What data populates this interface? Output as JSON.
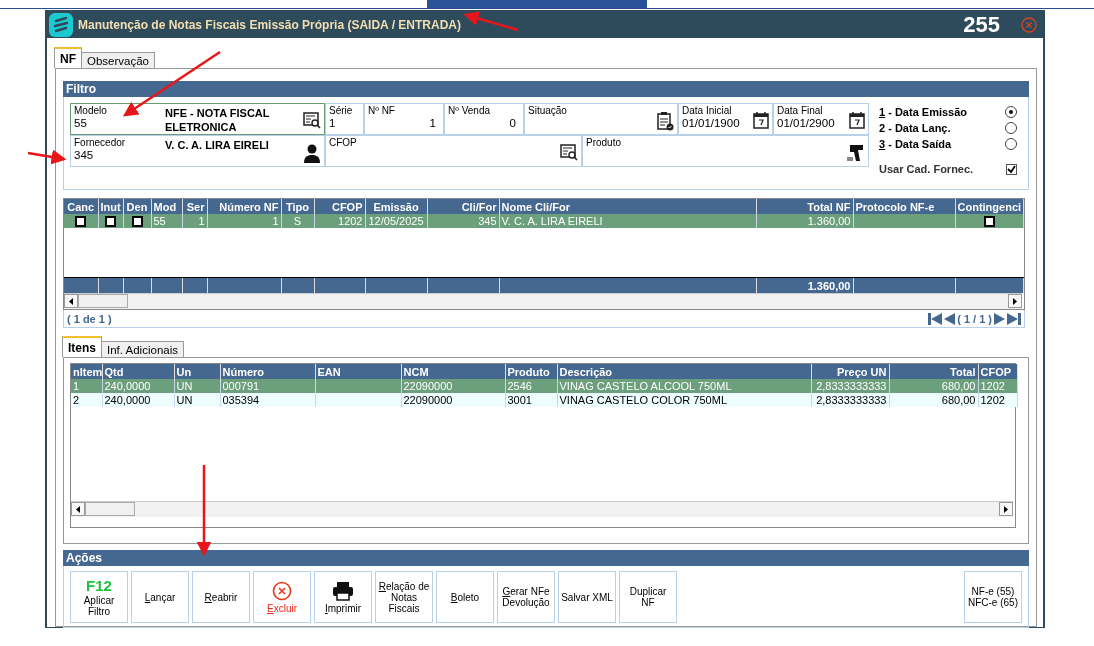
{
  "window": {
    "title": "Manutenção de Notas Fiscais Emissão Própria (SAIDA / ENTRADA)",
    "number": "255"
  },
  "tabs": [
    {
      "label": "NF",
      "selected": true
    },
    {
      "label": "Observação",
      "selected": false
    }
  ],
  "filter": {
    "title": "Filtro",
    "row_1": [
      {
        "label": "Modelo",
        "value": "55",
        "description": "NFE - NOTA FISCAL ELETRONICA",
        "kind": "lookup",
        "focused": true
      },
      {
        "label": "Série",
        "value": "1",
        "kind": "text"
      },
      {
        "label": "Nº NF",
        "value": "1",
        "kind": "number"
      },
      {
        "label": "Nº Venda",
        "value": "0",
        "kind": "number"
      },
      {
        "label": "Situação",
        "kind": "clipboard"
      },
      {
        "label": "Data Inicial",
        "value": "01/01/1900",
        "kind": "calendar"
      },
      {
        "label": "Data Final",
        "value": "01/01/2900",
        "kind": "calendar"
      }
    ],
    "row_2": [
      {
        "label": "Fornecedor",
        "value": "345",
        "description": "V. C. A. LIRA EIRELI",
        "kind": "person",
        "focused": false
      },
      {
        "label": "CFOP",
        "kind": "lookup"
      },
      {
        "label": "Produto",
        "kind": "scanner"
      }
    ],
    "date_options": [
      {
        "label": "1 - Data Emissão",
        "accel": true,
        "selected": true
      },
      {
        "label": "2 - Data Lanç.",
        "accel": false,
        "selected": false
      },
      {
        "label": "3 - Data Saída",
        "accel": true,
        "selected": false
      }
    ],
    "checkbox": {
      "label": "Usar Cad. Fornec.",
      "checked": true
    }
  },
  "grid": {
    "columns": [
      {
        "label": "Canc",
        "kind": "check"
      },
      {
        "label": "Inut",
        "kind": "check"
      },
      {
        "label": "Den",
        "kind": "check"
      },
      {
        "label": "Mod",
        "kind": "text"
      },
      {
        "label": "Ser",
        "kind": "number"
      },
      {
        "label": "Número NF",
        "kind": "number"
      },
      {
        "label": "Tipo",
        "kind": "center"
      },
      {
        "label": "CFOP",
        "kind": "number"
      },
      {
        "label": "Emissão",
        "kind": "center"
      },
      {
        "label": "Cli/For",
        "kind": "number"
      },
      {
        "label": "Nome Cli/For",
        "kind": "text"
      },
      {
        "label": "Total NF",
        "kind": "number",
        "footer": "1.360,00"
      },
      {
        "label": "Protocolo NF-e",
        "kind": "text"
      },
      {
        "label": "Contingenci",
        "kind": "check"
      }
    ],
    "rows": [
      {
        "selected": true,
        "cells": [
          false,
          false,
          false,
          "55",
          "1",
          "1",
          "S",
          "1202",
          "12/05/2025",
          "345",
          "V. C. A. LIRA EIRELI",
          "1.360,00",
          null,
          false
        ]
      }
    ],
    "count": "( 1 de 1 )",
    "page": "( 1 / 1 )"
  },
  "item_tabs": [
    {
      "label": "Itens",
      "selected": true
    },
    {
      "label": "Inf. Adicionais",
      "selected": false
    }
  ],
  "items": {
    "columns": [
      {
        "label": "nItem",
        "kind": "text"
      },
      {
        "label": "Qtd",
        "kind": "text"
      },
      {
        "label": "Un",
        "kind": "text"
      },
      {
        "label": "Número",
        "kind": "text"
      },
      {
        "label": "EAN",
        "kind": "text"
      },
      {
        "label": "NCM",
        "kind": "text"
      },
      {
        "label": "Produto",
        "kind": "text"
      },
      {
        "label": "Descrição",
        "kind": "text"
      },
      {
        "label": "Preço UN",
        "kind": "number"
      },
      {
        "label": "Total",
        "kind": "number"
      },
      {
        "label": "CFOP",
        "kind": "text"
      }
    ],
    "rows": [
      {
        "selected": true,
        "cells": [
          "1",
          "240,0000",
          "UN",
          "000791",
          null,
          "22090000",
          "2546",
          "VINAG CASTELO ALCOOL 750ML",
          "2,8333333333",
          "680,00",
          "1202"
        ]
      },
      {
        "selected": false,
        "cells": [
          "2",
          "240,0000",
          "UN",
          "035394",
          null,
          "22090000",
          "3001",
          "VINAG CASTELO COLOR 750ML",
          "2,8333333333",
          "680,00",
          "1202"
        ]
      }
    ]
  },
  "actions": {
    "title": "Ações",
    "buttons": [
      {
        "label": "Aplicar Filtro",
        "kind": "hotkey",
        "hotkey": "F12",
        "accel": false
      },
      {
        "label": "Lançar",
        "kind": "plain",
        "accel": true
      },
      {
        "label": "Reabrir",
        "kind": "plain",
        "accel": true
      },
      {
        "label": "Excluir",
        "accel": true,
        "kind": "danger"
      },
      {
        "label": "Imprimir",
        "kind": "printer",
        "accel": true
      },
      {
        "label": "Relação de Notas Fiscais",
        "kind": "plain",
        "accel": true
      },
      {
        "label": "Boleto",
        "kind": "plain",
        "accel": true
      },
      {
        "label": "Gerar NFe Devolução",
        "kind": "plain",
        "accel": true
      },
      {
        "label": "Salvar XML",
        "kind": "plain",
        "accel": false
      },
      {
        "label": "Duplicar NF",
        "kind": "plain",
        "accel": false
      },
      {
        "label": "NF-e (55) NFC-e (65)",
        "accel": false,
        "kind": "aside"
      }
    ]
  }
}
